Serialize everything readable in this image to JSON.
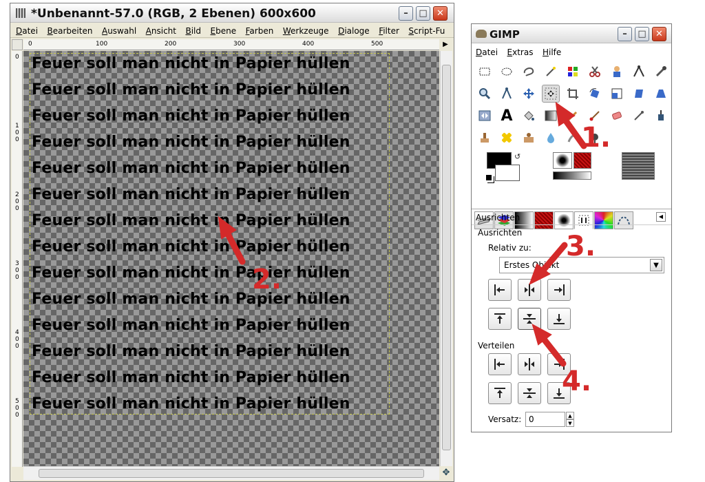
{
  "image_window": {
    "title": "*Unbenannt-57.0 (RGB, 2 Ebenen) 600x600",
    "menu": [
      "Datei",
      "Bearbeiten",
      "Auswahl",
      "Ansicht",
      "Bild",
      "Ebene",
      "Farben",
      "Werkzeuge",
      "Dialoge",
      "Filter",
      "Script-Fu"
    ],
    "ruler_h": [
      "0",
      "100",
      "200",
      "300",
      "400",
      "500"
    ],
    "ruler_v": [
      "0",
      "1\n0\n0",
      "2\n0\n0",
      "3\n0\n0",
      "4\n0\n0",
      "5\n0\n0"
    ],
    "text_lines": [
      "Feuer soll man nicht in Papier hüllen",
      "Feuer soll man nicht in Papier hüllen",
      "Feuer soll man nicht in Papier hüllen",
      "Feuer soll man nicht in Papier hüllen",
      "Feuer soll man nicht in Papier hüllen",
      "Feuer soll man nicht in Papier hüllen",
      "Feuer soll man nicht in Papier hüllen",
      "Feuer soll man nicht in Papier hüllen",
      "Feuer soll man nicht in Papier hüllen",
      "Feuer soll man nicht in Papier hüllen",
      "Feuer soll man nicht in Papier hüllen",
      "Feuer soll man nicht in Papier hüllen",
      "Feuer soll man nicht in Papier hüllen",
      "Feuer soll man nicht in Papier hüllen"
    ]
  },
  "toolbox": {
    "title": "GIMP",
    "menu": [
      "Datei",
      "Extras",
      "Hilfe"
    ],
    "panel_title": "Ausrichten",
    "section_align": "Ausrichten",
    "relative_label": "Relativ zu:",
    "relative_value": "Erstes Objekt",
    "section_distribute": "Verteilen",
    "offset_label": "Versatz:",
    "offset_value": "0"
  },
  "annotations": [
    "1.",
    "2.",
    "3.",
    "4."
  ],
  "colors": {
    "annotation": "#d42a2a",
    "foreground": "#000000",
    "background": "#ffffff"
  }
}
